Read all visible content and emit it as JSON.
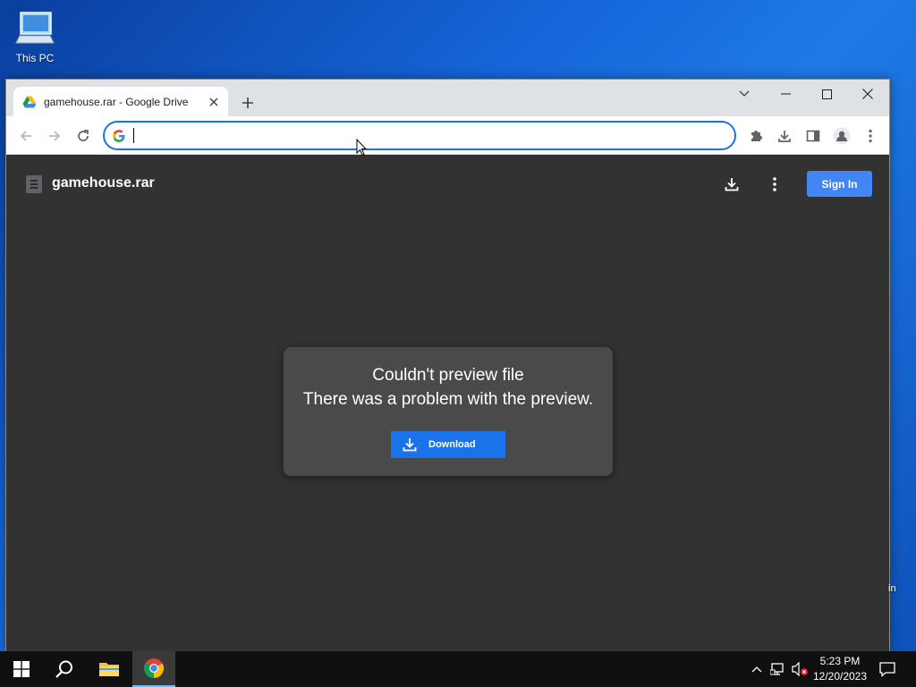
{
  "desktop": {
    "icon_label": "This PC"
  },
  "browser": {
    "tab": {
      "title": "gamehouse.rar - Google Drive"
    },
    "address_bar": {
      "value": "",
      "placeholder": ""
    }
  },
  "viewer": {
    "file_name": "gamehouse.rar",
    "sign_in_label": "Sign In",
    "error": {
      "title": "Couldn't preview file",
      "message": "There was a problem with the preview.",
      "download_label": "Download"
    }
  },
  "edge_text": "in",
  "taskbar": {
    "clock_time": "5:23 PM",
    "clock_date": "12/20/2023"
  },
  "colors": {
    "accent": "#1a73e8",
    "signin": "#4285f4",
    "viewer_bg": "#323232"
  }
}
